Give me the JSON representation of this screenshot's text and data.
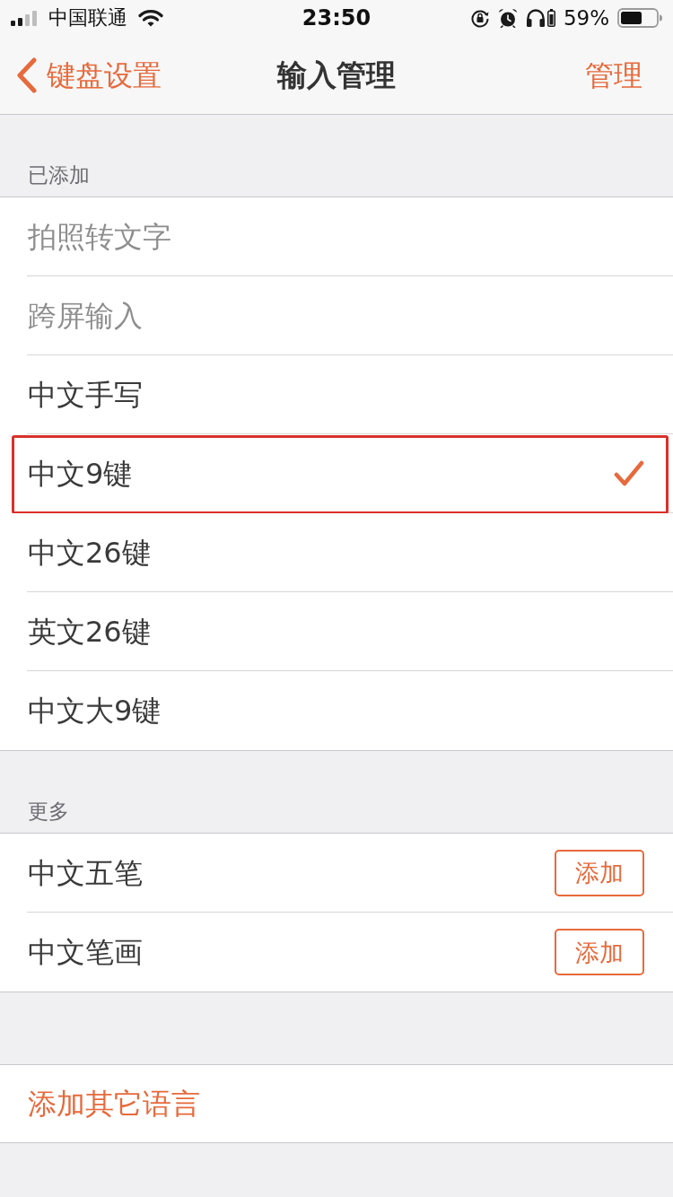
{
  "status_bar": {
    "carrier": "中国联通",
    "time": "23:50",
    "battery_text": "59%"
  },
  "nav": {
    "back": "键盘设置",
    "title": "输入管理",
    "action": "管理"
  },
  "sections": [
    {
      "header": "已添加",
      "items": [
        {
          "kind": "option",
          "label": "拍照转文字",
          "disabled": true,
          "selected": false,
          "highlighted": false
        },
        {
          "kind": "option",
          "label": "跨屏输入",
          "disabled": true,
          "selected": false,
          "highlighted": false
        },
        {
          "kind": "option",
          "label": "中文手写",
          "disabled": false,
          "selected": false,
          "highlighted": false
        },
        {
          "kind": "option",
          "label": "中文9键",
          "disabled": false,
          "selected": true,
          "highlighted": true
        },
        {
          "kind": "option",
          "label": "中文26键",
          "disabled": false,
          "selected": false,
          "highlighted": false
        },
        {
          "kind": "option",
          "label": "英文26键",
          "disabled": false,
          "selected": false,
          "highlighted": false
        },
        {
          "kind": "option",
          "label": "中文大9键",
          "disabled": false,
          "selected": false,
          "highlighted": false
        }
      ]
    },
    {
      "header": "更多",
      "items": [
        {
          "kind": "addable",
          "label": "中文五笔",
          "button": "添加"
        },
        {
          "kind": "addable",
          "label": "中文笔画",
          "button": "添加"
        }
      ]
    }
  ],
  "footer_link": "添加其它语言"
}
